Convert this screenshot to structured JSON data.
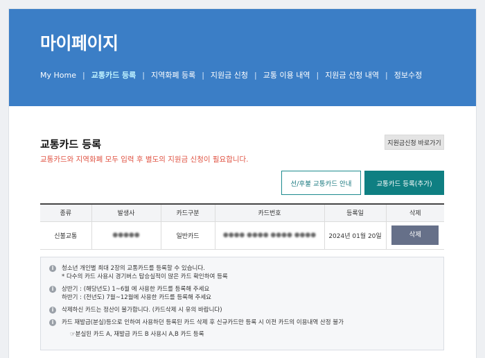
{
  "header": {
    "title": "마이페이지",
    "nav": [
      "My Home",
      "교통카드 등록",
      "지역화폐 등록",
      "지원금 신청",
      "교통 이용 내역",
      "지원금 신청 내역",
      "정보수정"
    ],
    "active_index": 1,
    "background_color": "#3b7ec6"
  },
  "section": {
    "title": "교통카드 등록",
    "notice": "교통카드와 지역화폐 모두 입력 후 별도의 지원금 신청이 필요합니다.",
    "shortcut_label": "지원금신청 바로가기",
    "guide_button": "선/후불 교통카드 안내",
    "register_button": "교통카드 등록(추가)"
  },
  "table": {
    "headers": [
      "종류",
      "발생사",
      "카드구분",
      "카드번호",
      "등록일",
      "삭제"
    ],
    "rows": [
      {
        "type": "신불교통",
        "issuer": "●●●●●",
        "category": "일반카드",
        "number": "●●●● ●●●● ●●●● ●●●●",
        "date": "2024년 01월 20일",
        "delete_label": "삭제"
      }
    ]
  },
  "info": {
    "icon": "info-circle-icon",
    "items": [
      {
        "lines": [
          "청소년 개인별 최대 2장의 교통카드를 등록할 수 있습니다.",
          "* 다수의 카드 사용시 경기버스 탑승실적이 많은 카드 확인하여 등록"
        ]
      },
      {
        "lines": [
          "상반기 : (해당년도) 1~6월 에 사용한 카드를 등록해 주세요",
          "하반기 : (전년도) 7월~12월에 사용한 카드를 등록해 주세요"
        ]
      },
      {
        "lines": [
          "삭제하신 카드는 정산이 불가합니다. (카드삭제 시 유의 바랍니다)"
        ]
      },
      {
        "lines": [
          "카드 재발급(분실)등으로 인하여 사용하던 등록된 카드 삭제 후 신규카드만 등록 시 이전 카드의 이용내역 산정 불가"
        ]
      }
    ],
    "example": "☞분실된 카드 A, 재발급 카드 B 사용시 A,B 카드 등록"
  }
}
